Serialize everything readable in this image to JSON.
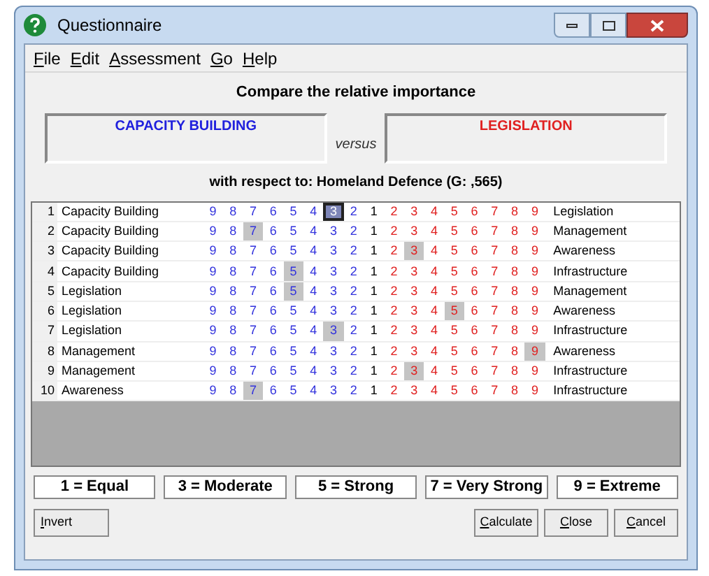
{
  "window": {
    "title": "Questionnaire"
  },
  "menu": [
    {
      "label": "File"
    },
    {
      "label": "Edit"
    },
    {
      "label": "Assessment"
    },
    {
      "label": "Go"
    },
    {
      "label": "Help"
    }
  ],
  "heading": "Compare the relative importance",
  "left_item": "CAPACITY BUILDING",
  "versus": "versus",
  "right_item": "LEGISLATION",
  "respect": "with respect to: Homeland Defence (G: ,565)",
  "rows": [
    {
      "number": "1",
      "left": "Capacity Building",
      "right": "Legislation",
      "focused": true,
      "cells": [
        {
          "label": "9",
          "kind": "left",
          "selected": false
        },
        {
          "label": "8",
          "kind": "left",
          "selected": false
        },
        {
          "label": "7",
          "kind": "left",
          "selected": false
        },
        {
          "label": "6",
          "kind": "left",
          "selected": false
        },
        {
          "label": "5",
          "kind": "left",
          "selected": false
        },
        {
          "label": "4",
          "kind": "left",
          "selected": false
        },
        {
          "label": "3",
          "kind": "left",
          "selected": true
        },
        {
          "label": "2",
          "kind": "left",
          "selected": false
        },
        {
          "label": "1",
          "kind": "center",
          "selected": false
        },
        {
          "label": "2",
          "kind": "right",
          "selected": false
        },
        {
          "label": "3",
          "kind": "right",
          "selected": false
        },
        {
          "label": "4",
          "kind": "right",
          "selected": false
        },
        {
          "label": "5",
          "kind": "right",
          "selected": false
        },
        {
          "label": "6",
          "kind": "right",
          "selected": false
        },
        {
          "label": "7",
          "kind": "right",
          "selected": false
        },
        {
          "label": "8",
          "kind": "right",
          "selected": false
        },
        {
          "label": "9",
          "kind": "right",
          "selected": false
        }
      ]
    },
    {
      "number": "2",
      "left": "Capacity Building",
      "right": "Management",
      "focused": false,
      "cells": [
        {
          "label": "9",
          "kind": "left",
          "selected": false
        },
        {
          "label": "8",
          "kind": "left",
          "selected": false
        },
        {
          "label": "7",
          "kind": "left",
          "selected": true
        },
        {
          "label": "6",
          "kind": "left",
          "selected": false
        },
        {
          "label": "5",
          "kind": "left",
          "selected": false
        },
        {
          "label": "4",
          "kind": "left",
          "selected": false
        },
        {
          "label": "3",
          "kind": "left",
          "selected": false
        },
        {
          "label": "2",
          "kind": "left",
          "selected": false
        },
        {
          "label": "1",
          "kind": "center",
          "selected": false
        },
        {
          "label": "2",
          "kind": "right",
          "selected": false
        },
        {
          "label": "3",
          "kind": "right",
          "selected": false
        },
        {
          "label": "4",
          "kind": "right",
          "selected": false
        },
        {
          "label": "5",
          "kind": "right",
          "selected": false
        },
        {
          "label": "6",
          "kind": "right",
          "selected": false
        },
        {
          "label": "7",
          "kind": "right",
          "selected": false
        },
        {
          "label": "8",
          "kind": "right",
          "selected": false
        },
        {
          "label": "9",
          "kind": "right",
          "selected": false
        }
      ]
    },
    {
      "number": "3",
      "left": "Capacity Building",
      "right": "Awareness",
      "focused": false,
      "cells": [
        {
          "label": "9",
          "kind": "left",
          "selected": false
        },
        {
          "label": "8",
          "kind": "left",
          "selected": false
        },
        {
          "label": "7",
          "kind": "left",
          "selected": false
        },
        {
          "label": "6",
          "kind": "left",
          "selected": false
        },
        {
          "label": "5",
          "kind": "left",
          "selected": false
        },
        {
          "label": "4",
          "kind": "left",
          "selected": false
        },
        {
          "label": "3",
          "kind": "left",
          "selected": false
        },
        {
          "label": "2",
          "kind": "left",
          "selected": false
        },
        {
          "label": "1",
          "kind": "center",
          "selected": false
        },
        {
          "label": "2",
          "kind": "right",
          "selected": false
        },
        {
          "label": "3",
          "kind": "right",
          "selected": true
        },
        {
          "label": "4",
          "kind": "right",
          "selected": false
        },
        {
          "label": "5",
          "kind": "right",
          "selected": false
        },
        {
          "label": "6",
          "kind": "right",
          "selected": false
        },
        {
          "label": "7",
          "kind": "right",
          "selected": false
        },
        {
          "label": "8",
          "kind": "right",
          "selected": false
        },
        {
          "label": "9",
          "kind": "right",
          "selected": false
        }
      ]
    },
    {
      "number": "4",
      "left": "Capacity Building",
      "right": "Infrastructure",
      "focused": false,
      "cells": [
        {
          "label": "9",
          "kind": "left",
          "selected": false
        },
        {
          "label": "8",
          "kind": "left",
          "selected": false
        },
        {
          "label": "7",
          "kind": "left",
          "selected": false
        },
        {
          "label": "6",
          "kind": "left",
          "selected": false
        },
        {
          "label": "5",
          "kind": "left",
          "selected": true
        },
        {
          "label": "4",
          "kind": "left",
          "selected": false
        },
        {
          "label": "3",
          "kind": "left",
          "selected": false
        },
        {
          "label": "2",
          "kind": "left",
          "selected": false
        },
        {
          "label": "1",
          "kind": "center",
          "selected": false
        },
        {
          "label": "2",
          "kind": "right",
          "selected": false
        },
        {
          "label": "3",
          "kind": "right",
          "selected": false
        },
        {
          "label": "4",
          "kind": "right",
          "selected": false
        },
        {
          "label": "5",
          "kind": "right",
          "selected": false
        },
        {
          "label": "6",
          "kind": "right",
          "selected": false
        },
        {
          "label": "7",
          "kind": "right",
          "selected": false
        },
        {
          "label": "8",
          "kind": "right",
          "selected": false
        },
        {
          "label": "9",
          "kind": "right",
          "selected": false
        }
      ]
    },
    {
      "number": "5",
      "left": "Legislation",
      "right": "Management",
      "focused": false,
      "cells": [
        {
          "label": "9",
          "kind": "left",
          "selected": false
        },
        {
          "label": "8",
          "kind": "left",
          "selected": false
        },
        {
          "label": "7",
          "kind": "left",
          "selected": false
        },
        {
          "label": "6",
          "kind": "left",
          "selected": false
        },
        {
          "label": "5",
          "kind": "left",
          "selected": true
        },
        {
          "label": "4",
          "kind": "left",
          "selected": false
        },
        {
          "label": "3",
          "kind": "left",
          "selected": false
        },
        {
          "label": "2",
          "kind": "left",
          "selected": false
        },
        {
          "label": "1",
          "kind": "center",
          "selected": false
        },
        {
          "label": "2",
          "kind": "right",
          "selected": false
        },
        {
          "label": "3",
          "kind": "right",
          "selected": false
        },
        {
          "label": "4",
          "kind": "right",
          "selected": false
        },
        {
          "label": "5",
          "kind": "right",
          "selected": false
        },
        {
          "label": "6",
          "kind": "right",
          "selected": false
        },
        {
          "label": "7",
          "kind": "right",
          "selected": false
        },
        {
          "label": "8",
          "kind": "right",
          "selected": false
        },
        {
          "label": "9",
          "kind": "right",
          "selected": false
        }
      ]
    },
    {
      "number": "6",
      "left": "Legislation",
      "right": "Awareness",
      "focused": false,
      "cells": [
        {
          "label": "9",
          "kind": "left",
          "selected": false
        },
        {
          "label": "8",
          "kind": "left",
          "selected": false
        },
        {
          "label": "7",
          "kind": "left",
          "selected": false
        },
        {
          "label": "6",
          "kind": "left",
          "selected": false
        },
        {
          "label": "5",
          "kind": "left",
          "selected": false
        },
        {
          "label": "4",
          "kind": "left",
          "selected": false
        },
        {
          "label": "3",
          "kind": "left",
          "selected": false
        },
        {
          "label": "2",
          "kind": "left",
          "selected": false
        },
        {
          "label": "1",
          "kind": "center",
          "selected": false
        },
        {
          "label": "2",
          "kind": "right",
          "selected": false
        },
        {
          "label": "3",
          "kind": "right",
          "selected": false
        },
        {
          "label": "4",
          "kind": "right",
          "selected": false
        },
        {
          "label": "5",
          "kind": "right",
          "selected": true
        },
        {
          "label": "6",
          "kind": "right",
          "selected": false
        },
        {
          "label": "7",
          "kind": "right",
          "selected": false
        },
        {
          "label": "8",
          "kind": "right",
          "selected": false
        },
        {
          "label": "9",
          "kind": "right",
          "selected": false
        }
      ]
    },
    {
      "number": "7",
      "left": "Legislation",
      "right": "Infrastructure",
      "focused": false,
      "cells": [
        {
          "label": "9",
          "kind": "left",
          "selected": false
        },
        {
          "label": "8",
          "kind": "left",
          "selected": false
        },
        {
          "label": "7",
          "kind": "left",
          "selected": false
        },
        {
          "label": "6",
          "kind": "left",
          "selected": false
        },
        {
          "label": "5",
          "kind": "left",
          "selected": false
        },
        {
          "label": "4",
          "kind": "left",
          "selected": false
        },
        {
          "label": "3",
          "kind": "left",
          "selected": true
        },
        {
          "label": "2",
          "kind": "left",
          "selected": false
        },
        {
          "label": "1",
          "kind": "center",
          "selected": false
        },
        {
          "label": "2",
          "kind": "right",
          "selected": false
        },
        {
          "label": "3",
          "kind": "right",
          "selected": false
        },
        {
          "label": "4",
          "kind": "right",
          "selected": false
        },
        {
          "label": "5",
          "kind": "right",
          "selected": false
        },
        {
          "label": "6",
          "kind": "right",
          "selected": false
        },
        {
          "label": "7",
          "kind": "right",
          "selected": false
        },
        {
          "label": "8",
          "kind": "right",
          "selected": false
        },
        {
          "label": "9",
          "kind": "right",
          "selected": false
        }
      ]
    },
    {
      "number": "8",
      "left": "Management",
      "right": "Awareness",
      "focused": false,
      "cells": [
        {
          "label": "9",
          "kind": "left",
          "selected": false
        },
        {
          "label": "8",
          "kind": "left",
          "selected": false
        },
        {
          "label": "7",
          "kind": "left",
          "selected": false
        },
        {
          "label": "6",
          "kind": "left",
          "selected": false
        },
        {
          "label": "5",
          "kind": "left",
          "selected": false
        },
        {
          "label": "4",
          "kind": "left",
          "selected": false
        },
        {
          "label": "3",
          "kind": "left",
          "selected": false
        },
        {
          "label": "2",
          "kind": "left",
          "selected": false
        },
        {
          "label": "1",
          "kind": "center",
          "selected": false
        },
        {
          "label": "2",
          "kind": "right",
          "selected": false
        },
        {
          "label": "3",
          "kind": "right",
          "selected": false
        },
        {
          "label": "4",
          "kind": "right",
          "selected": false
        },
        {
          "label": "5",
          "kind": "right",
          "selected": false
        },
        {
          "label": "6",
          "kind": "right",
          "selected": false
        },
        {
          "label": "7",
          "kind": "right",
          "selected": false
        },
        {
          "label": "8",
          "kind": "right",
          "selected": false
        },
        {
          "label": "9",
          "kind": "right",
          "selected": true
        }
      ]
    },
    {
      "number": "9",
      "left": "Management",
      "right": "Infrastructure",
      "focused": false,
      "cells": [
        {
          "label": "9",
          "kind": "left",
          "selected": false
        },
        {
          "label": "8",
          "kind": "left",
          "selected": false
        },
        {
          "label": "7",
          "kind": "left",
          "selected": false
        },
        {
          "label": "6",
          "kind": "left",
          "selected": false
        },
        {
          "label": "5",
          "kind": "left",
          "selected": false
        },
        {
          "label": "4",
          "kind": "left",
          "selected": false
        },
        {
          "label": "3",
          "kind": "left",
          "selected": false
        },
        {
          "label": "2",
          "kind": "left",
          "selected": false
        },
        {
          "label": "1",
          "kind": "center",
          "selected": false
        },
        {
          "label": "2",
          "kind": "right",
          "selected": false
        },
        {
          "label": "3",
          "kind": "right",
          "selected": true
        },
        {
          "label": "4",
          "kind": "right",
          "selected": false
        },
        {
          "label": "5",
          "kind": "right",
          "selected": false
        },
        {
          "label": "6",
          "kind": "right",
          "selected": false
        },
        {
          "label": "7",
          "kind": "right",
          "selected": false
        },
        {
          "label": "8",
          "kind": "right",
          "selected": false
        },
        {
          "label": "9",
          "kind": "right",
          "selected": false
        }
      ]
    },
    {
      "number": "10",
      "left": "Awareness",
      "right": "Infrastructure",
      "focused": false,
      "cells": [
        {
          "label": "9",
          "kind": "left",
          "selected": false
        },
        {
          "label": "8",
          "kind": "left",
          "selected": false
        },
        {
          "label": "7",
          "kind": "left",
          "selected": true
        },
        {
          "label": "6",
          "kind": "left",
          "selected": false
        },
        {
          "label": "5",
          "kind": "left",
          "selected": false
        },
        {
          "label": "4",
          "kind": "left",
          "selected": false
        },
        {
          "label": "3",
          "kind": "left",
          "selected": false
        },
        {
          "label": "2",
          "kind": "left",
          "selected": false
        },
        {
          "label": "1",
          "kind": "center",
          "selected": false
        },
        {
          "label": "2",
          "kind": "right",
          "selected": false
        },
        {
          "label": "3",
          "kind": "right",
          "selected": false
        },
        {
          "label": "4",
          "kind": "right",
          "selected": false
        },
        {
          "label": "5",
          "kind": "right",
          "selected": false
        },
        {
          "label": "6",
          "kind": "right",
          "selected": false
        },
        {
          "label": "7",
          "kind": "right",
          "selected": false
        },
        {
          "label": "8",
          "kind": "right",
          "selected": false
        },
        {
          "label": "9",
          "kind": "right",
          "selected": false
        }
      ]
    }
  ],
  "legend": [
    "1 = Equal",
    "3 = Moderate",
    "5 = Strong",
    "7 = Very Strong",
    "9 = Extreme"
  ],
  "buttons_left": [
    {
      "label": "Invert"
    }
  ],
  "buttons_right": [
    {
      "label": "Calculate"
    },
    {
      "label": "Close"
    },
    {
      "label": "Cancel"
    }
  ]
}
